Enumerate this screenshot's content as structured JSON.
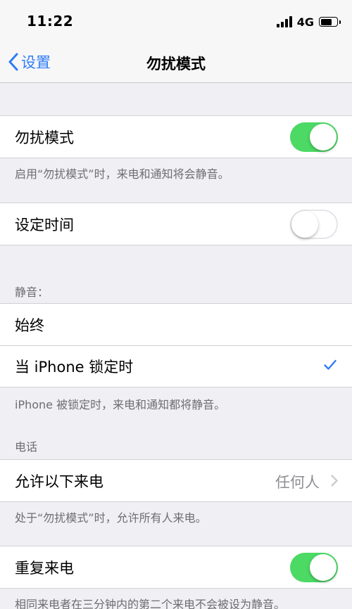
{
  "status_bar": {
    "time": "11:22",
    "network": "4G",
    "icons": [
      "signal-icon",
      "battery-icon"
    ]
  },
  "nav": {
    "back_label": "设置",
    "title": "勿扰模式"
  },
  "sections": {
    "dnd": {
      "label": "勿扰模式",
      "enabled": true,
      "footnote": "启用“勿扰模式”时，来电和通知将会静音。"
    },
    "scheduled": {
      "label": "设定时间",
      "enabled": false
    },
    "silence": {
      "header": "静音：",
      "options": [
        "始终",
        "当 iPhone 锁定时"
      ],
      "selected_index": 1,
      "footnote": "iPhone 被锁定时，来电和通知都将静音。"
    },
    "phone": {
      "header": "电话",
      "allow_label": "允许以下来电",
      "allow_value": "任何人",
      "footnote": "处于“勿扰模式”时，允许所有人来电。"
    },
    "repeated": {
      "label": "重复来电",
      "enabled": true,
      "footnote": "相同来电者在三分钟内的第二个来电不会被设为静音。"
    }
  },
  "colors": {
    "accent": "#2f7cf6",
    "toggle_on": "#4cd964",
    "background": "#efeff4",
    "secondary_text": "#6d6d72",
    "value_text": "#8e8e93"
  }
}
